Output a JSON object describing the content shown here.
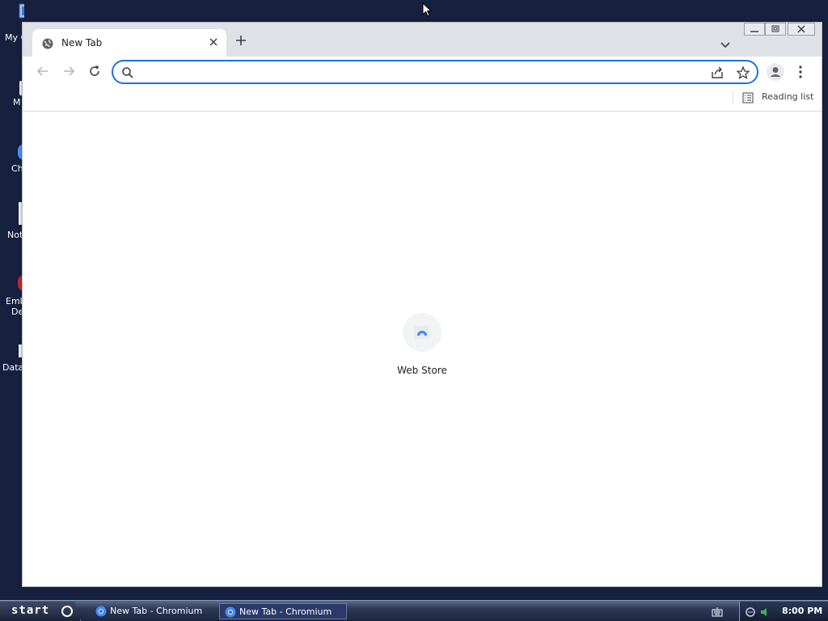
{
  "desktop": {
    "icons": [
      {
        "label": "My C",
        "icon": "computer-icon"
      },
      {
        "label": "M",
        "icon": "folder-icon"
      },
      {
        "label": "Ch",
        "icon": "chromium-icon"
      },
      {
        "label": "Not",
        "icon": "notepad-icon"
      },
      {
        "label": "Emb\nDe",
        "icon": "app-icon"
      },
      {
        "label": "Data",
        "icon": "database-icon"
      }
    ]
  },
  "browser": {
    "tab": {
      "title": "New Tab",
      "icon": "globe-icon"
    },
    "omnibox": {
      "value": "",
      "placeholder": ""
    },
    "bookmarks_bar": {
      "reading_list_label": "Reading list"
    },
    "shortcuts": [
      {
        "label": "Web Store",
        "icon": "web-store-icon"
      }
    ]
  },
  "taskbar": {
    "start_label": "start",
    "items": [
      {
        "label": "New Tab - Chromium",
        "active": false
      },
      {
        "label": "New Tab - Chromium",
        "active": true
      }
    ],
    "clock": "8:00 PM"
  },
  "colors": {
    "desktop_bg": "#16203f",
    "accent": "#1a73e8",
    "titlebar": "#dee1e6"
  }
}
